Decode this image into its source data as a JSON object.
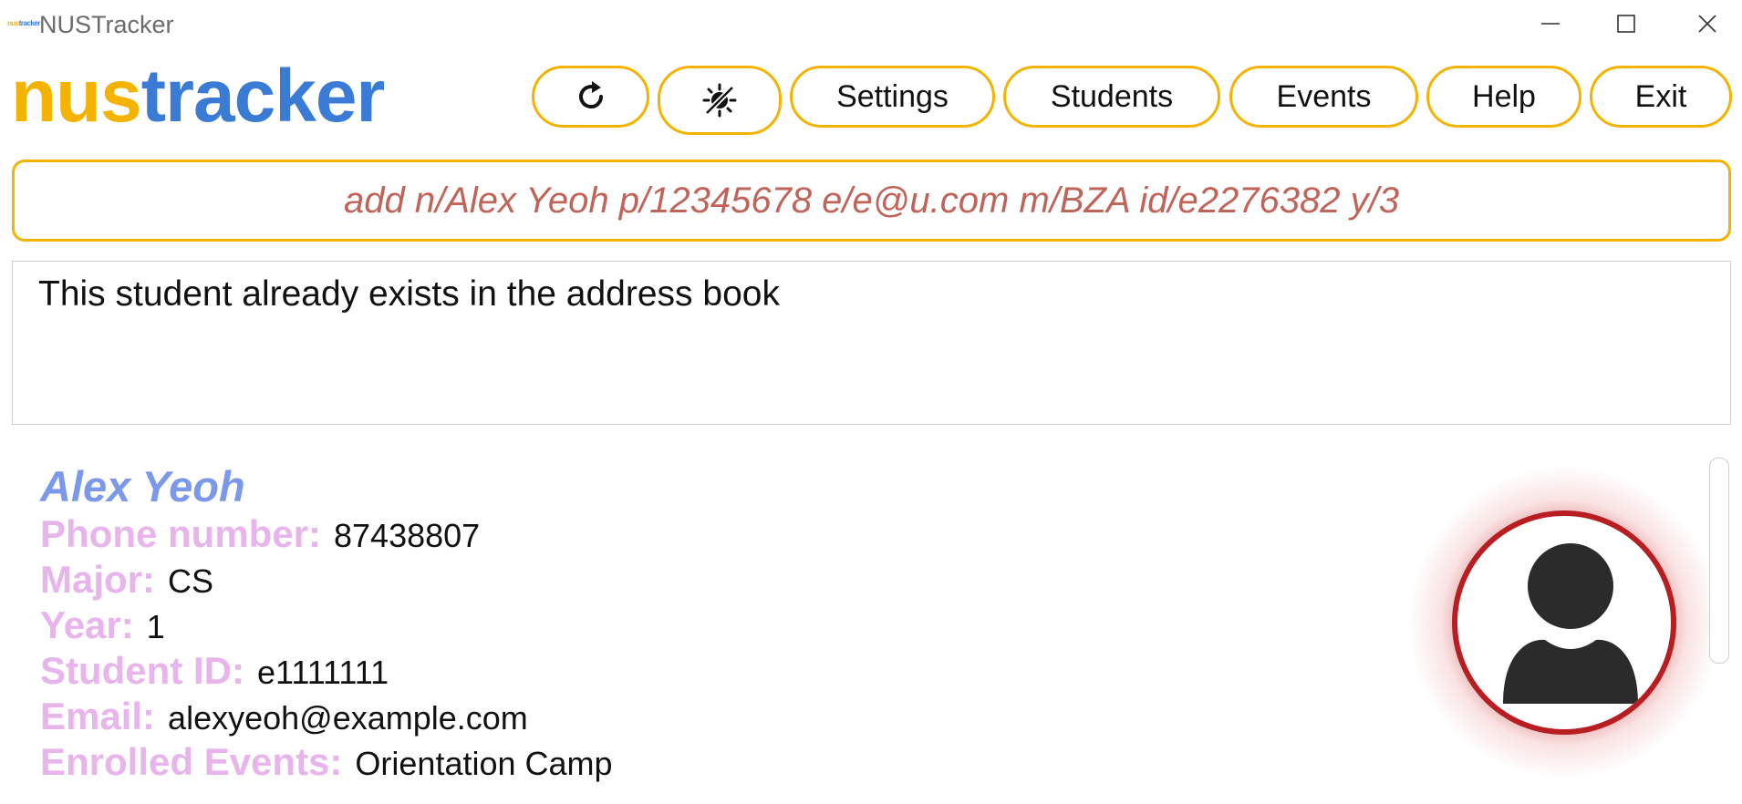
{
  "window": {
    "title": "NUSTracker",
    "icon_text_a": "nus",
    "icon_text_b": "tracker"
  },
  "logo": {
    "part1": "nus",
    "part2": "tracker"
  },
  "toolbar": {
    "refresh_icon": "refresh-icon",
    "theme_icon": "theme-toggle-icon",
    "settings_label": "Settings",
    "students_label": "Students",
    "events_label": "Events",
    "help_label": "Help",
    "exit_label": "Exit"
  },
  "command": {
    "value": "add n/Alex Yeoh p/12345678 e/e@u.com m/BZA id/e2276382 y/3"
  },
  "result": {
    "message": "This student already exists in the address book"
  },
  "student": {
    "name": "Alex Yeoh",
    "fields": [
      {
        "label": "Phone number:",
        "value": "87438807"
      },
      {
        "label": "Major:",
        "value": "CS"
      },
      {
        "label": "Year:",
        "value": "1"
      },
      {
        "label": "Student ID:",
        "value": "e1111111"
      },
      {
        "label": "Email:",
        "value": "alexyeoh@example.com"
      },
      {
        "label": "Enrolled Events:",
        "value": "Orientation Camp"
      }
    ],
    "avatar_icon": "user-avatar-icon"
  },
  "colors": {
    "accent": "#f5b301",
    "brand_blue": "#3a7bd5",
    "command_text": "#c0645a",
    "name": "#7b98ea",
    "field_label": "#e7b4ec",
    "avatar_ring": "#b81d22"
  }
}
